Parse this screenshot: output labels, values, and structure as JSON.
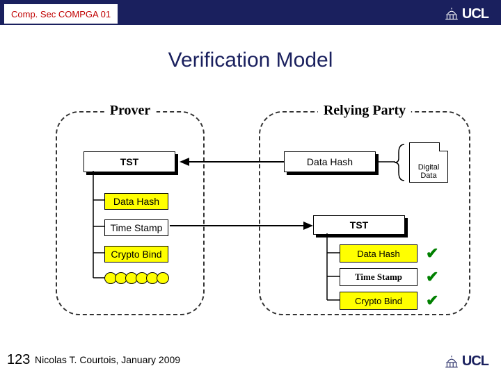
{
  "header": {
    "course_code": "Comp. Sec COMPGA 01",
    "logo_text": "UCL"
  },
  "title": "Verification Model",
  "prover": {
    "label": "Prover",
    "tst": "TST",
    "data_hash": "Data Hash",
    "time_stamp": "Time Stamp",
    "crypto_bind": "Crypto Bind"
  },
  "relying": {
    "label": "Relying Party",
    "data_hash": "Data Hash",
    "doc_label": "Digital\nData",
    "tst": "TST",
    "rows": {
      "data_hash": "Data Hash",
      "time_stamp": "Time Stamp",
      "crypto_bind": "Crypto Bind"
    }
  },
  "footer": {
    "page": "123",
    "author": "Nicolas T. Courtois, January 2009",
    "logo_text": "UCL"
  }
}
